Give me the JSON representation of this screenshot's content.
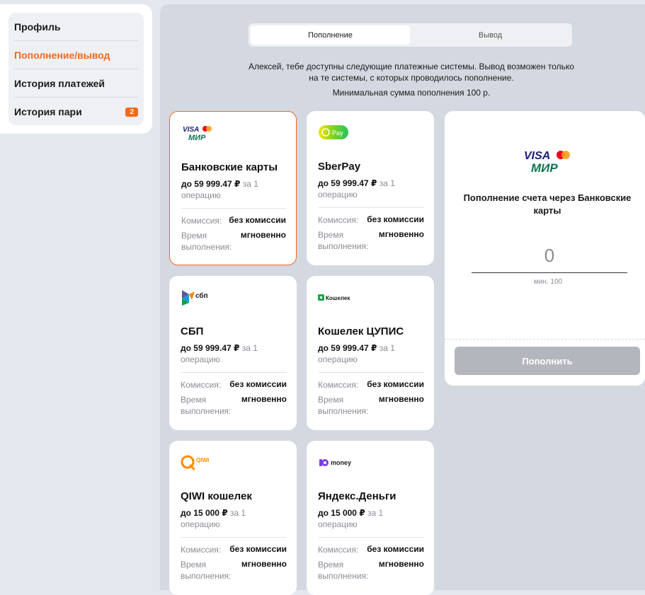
{
  "sidebar": {
    "items": [
      {
        "label": "Профиль"
      },
      {
        "label": "Пополнение/вывод"
      },
      {
        "label": "История платежей"
      },
      {
        "label": "История пари",
        "badge": "2"
      }
    ]
  },
  "tabs": [
    {
      "label": "Пополнение"
    },
    {
      "label": "Вывод"
    }
  ],
  "info": {
    "text": "Алексей, тебе доступны следующие платежные системы. Вывод возможен только на те системы, с которых проводилось пополнение.",
    "min": "Минимальная сумма пополнения 100 р."
  },
  "cards": [
    {
      "title": "Банковские карты",
      "limit_amount": "до 59 999.47 ₽",
      "limit_suffix": "за 1 операцию",
      "fee_label": "Комиссия:",
      "fee_value": "без комиссии",
      "time_label": "Время выполнения:",
      "time_value": "мгновенно",
      "logo": "visa-mir"
    },
    {
      "title": "SberPay",
      "limit_amount": "до 59 999.47 ₽",
      "limit_suffix": "за 1 операцию",
      "fee_label": "Комиссия:",
      "fee_value": "без комиссии",
      "time_label": "Время выполнения:",
      "time_value": "мгновенно",
      "logo": "sberpay",
      "logo_text": "Pay"
    },
    {
      "title": "СБП",
      "limit_amount": "до 59 999.47 ₽",
      "limit_suffix": "за 1 операцию",
      "fee_label": "Комиссия:",
      "fee_value": "без комиссии",
      "time_label": "Время выполнения:",
      "time_value": "мгновенно",
      "logo": "sbp",
      "logo_text": "сбп"
    },
    {
      "title": "Кошелек ЦУПИС",
      "limit_amount": "до 59 999.47 ₽",
      "limit_suffix": "за 1 операцию",
      "fee_label": "Комиссия:",
      "fee_value": "без комиссии",
      "time_label": "Время выполнения:",
      "time_value": "мгновенно",
      "logo": "koshelek",
      "logo_text": "Кошелек"
    },
    {
      "title": "QIWI кошелек",
      "limit_amount": "до 15 000 ₽",
      "limit_suffix": "за 1 операцию",
      "fee_label": "Комиссия:",
      "fee_value": "без комиссии",
      "time_label": "Время выполнения:",
      "time_value": "мгновенно",
      "logo": "qiwi",
      "logo_text": "QIWI"
    },
    {
      "title": "Яндекс.Деньги",
      "limit_amount": "до 15 000 ₽",
      "limit_suffix": "за 1 операцию",
      "fee_label": "Комиссия:",
      "fee_value": "без комиссии",
      "time_label": "Время выполнения:",
      "time_value": "мгновенно",
      "logo": "yoomoney",
      "logo_text": "money"
    }
  ],
  "deposit": {
    "title": "Пополнение счета через Банковские карты",
    "amount_placeholder": "0",
    "hint": "мин. 100",
    "button_label": "Пополнить"
  },
  "colors": {
    "accent": "#f06a1d",
    "panel": "#d4d8e0",
    "button_disabled": "#b3b6bd"
  }
}
